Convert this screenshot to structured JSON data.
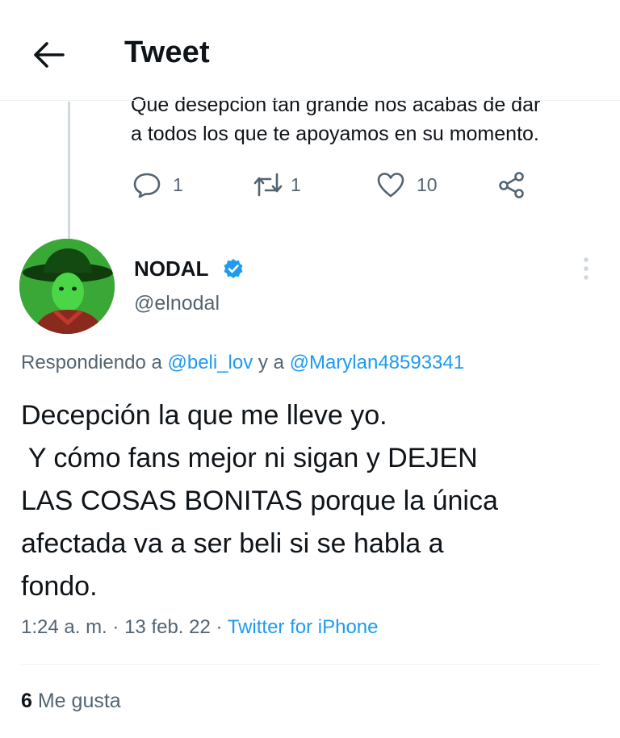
{
  "header": {
    "title": "Tweet",
    "back_icon": "arrow-left-icon"
  },
  "previous_tweet": {
    "text_line1": "Que desepcion tan grande nos acabas de dar",
    "text_line2": "a todos los que te apoyamos en su momento.",
    "actions": {
      "reply_count": "1",
      "retweet_count": "1",
      "like_count": "10"
    }
  },
  "tweet": {
    "author_name": "NODAL",
    "author_handle": "@elnodal",
    "verified": true,
    "replying_prefix": "Respondiendo a",
    "mention1": "@beli_lov",
    "replying_joiner": "y a",
    "mention2": "@Marylan48593341",
    "body_lines": [
      "Decepción la que me lleve yo.",
      " Y cómo fans mejor ni sigan y DEJEN",
      "LAS COSAS BONITAS porque la única",
      "afectada va a ser beli si se habla a",
      "fondo."
    ],
    "time": "1:24 a. m.",
    "date": "13 feb. 22",
    "source": "Twitter for iPhone",
    "separator": "·"
  },
  "stats": {
    "likes_count": "6",
    "likes_label": "Me gusta"
  },
  "colors": {
    "text": "#0f1419",
    "secondary": "#536471",
    "accent": "#1d9bf0",
    "divider": "#eff3f4"
  }
}
